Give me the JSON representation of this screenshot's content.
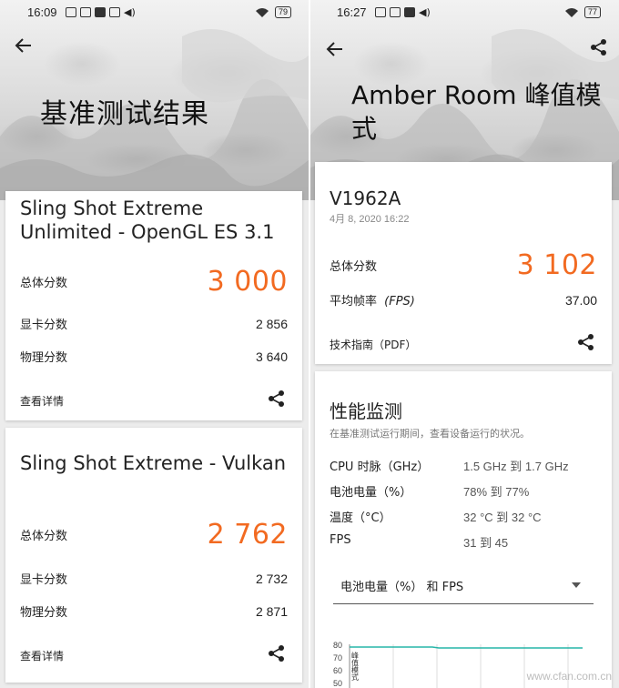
{
  "left": {
    "status": {
      "time": "16:09",
      "battery": "79"
    },
    "title": "基准测试结果",
    "cards": [
      {
        "title": "Sling Shot Extreme Unlimited - OpenGL ES 3.1",
        "total_label": "总体分数",
        "total_value": "3 000",
        "gpu_label": "显卡分数",
        "gpu_value": "2 856",
        "physics_label": "物理分数",
        "physics_value": "3 640",
        "detail_label": "查看详情"
      },
      {
        "title": "Sling Shot Extreme - Vulkan",
        "total_label": "总体分数",
        "total_value": "2 762",
        "gpu_label": "显卡分数",
        "gpu_value": "2 732",
        "physics_label": "物理分数",
        "physics_value": "2 871",
        "detail_label": "查看详情"
      }
    ]
  },
  "right": {
    "status": {
      "time": "16:27",
      "battery": "77"
    },
    "title": "Amber Room 峰值模式",
    "device": "V1962A",
    "date": "4月 8, 2020 16:22",
    "total_label": "总体分数",
    "total_value": "3 102",
    "fps_label": "平均帧率",
    "fps_unit": "(FPS)",
    "fps_value": "37.00",
    "pdf_label": "技术指南（PDF）",
    "monitor": {
      "title": "性能监测",
      "subtitle": "在基准测试运行期间，查看设备运行的状况。",
      "rows": [
        {
          "k": "CPU 时脉（GHz）",
          "v": "1.5 GHz 到 1.7 GHz"
        },
        {
          "k": "电池电量（%）",
          "v": "78% 到 77%"
        },
        {
          "k": "温度（°C）",
          "v": "32 °C 到 32 °C"
        },
        {
          "k": "FPS",
          "v": "31 到 45"
        }
      ],
      "dropdown": "电池电量（%） 和 FPS",
      "chart_label": "峰值模式",
      "chart_ticks": [
        "80",
        "70",
        "60",
        "50"
      ]
    }
  },
  "colors": {
    "accent": "#f26a21",
    "chart_line": "#26b5a8"
  },
  "watermark": "www.cfan.com.cn"
}
